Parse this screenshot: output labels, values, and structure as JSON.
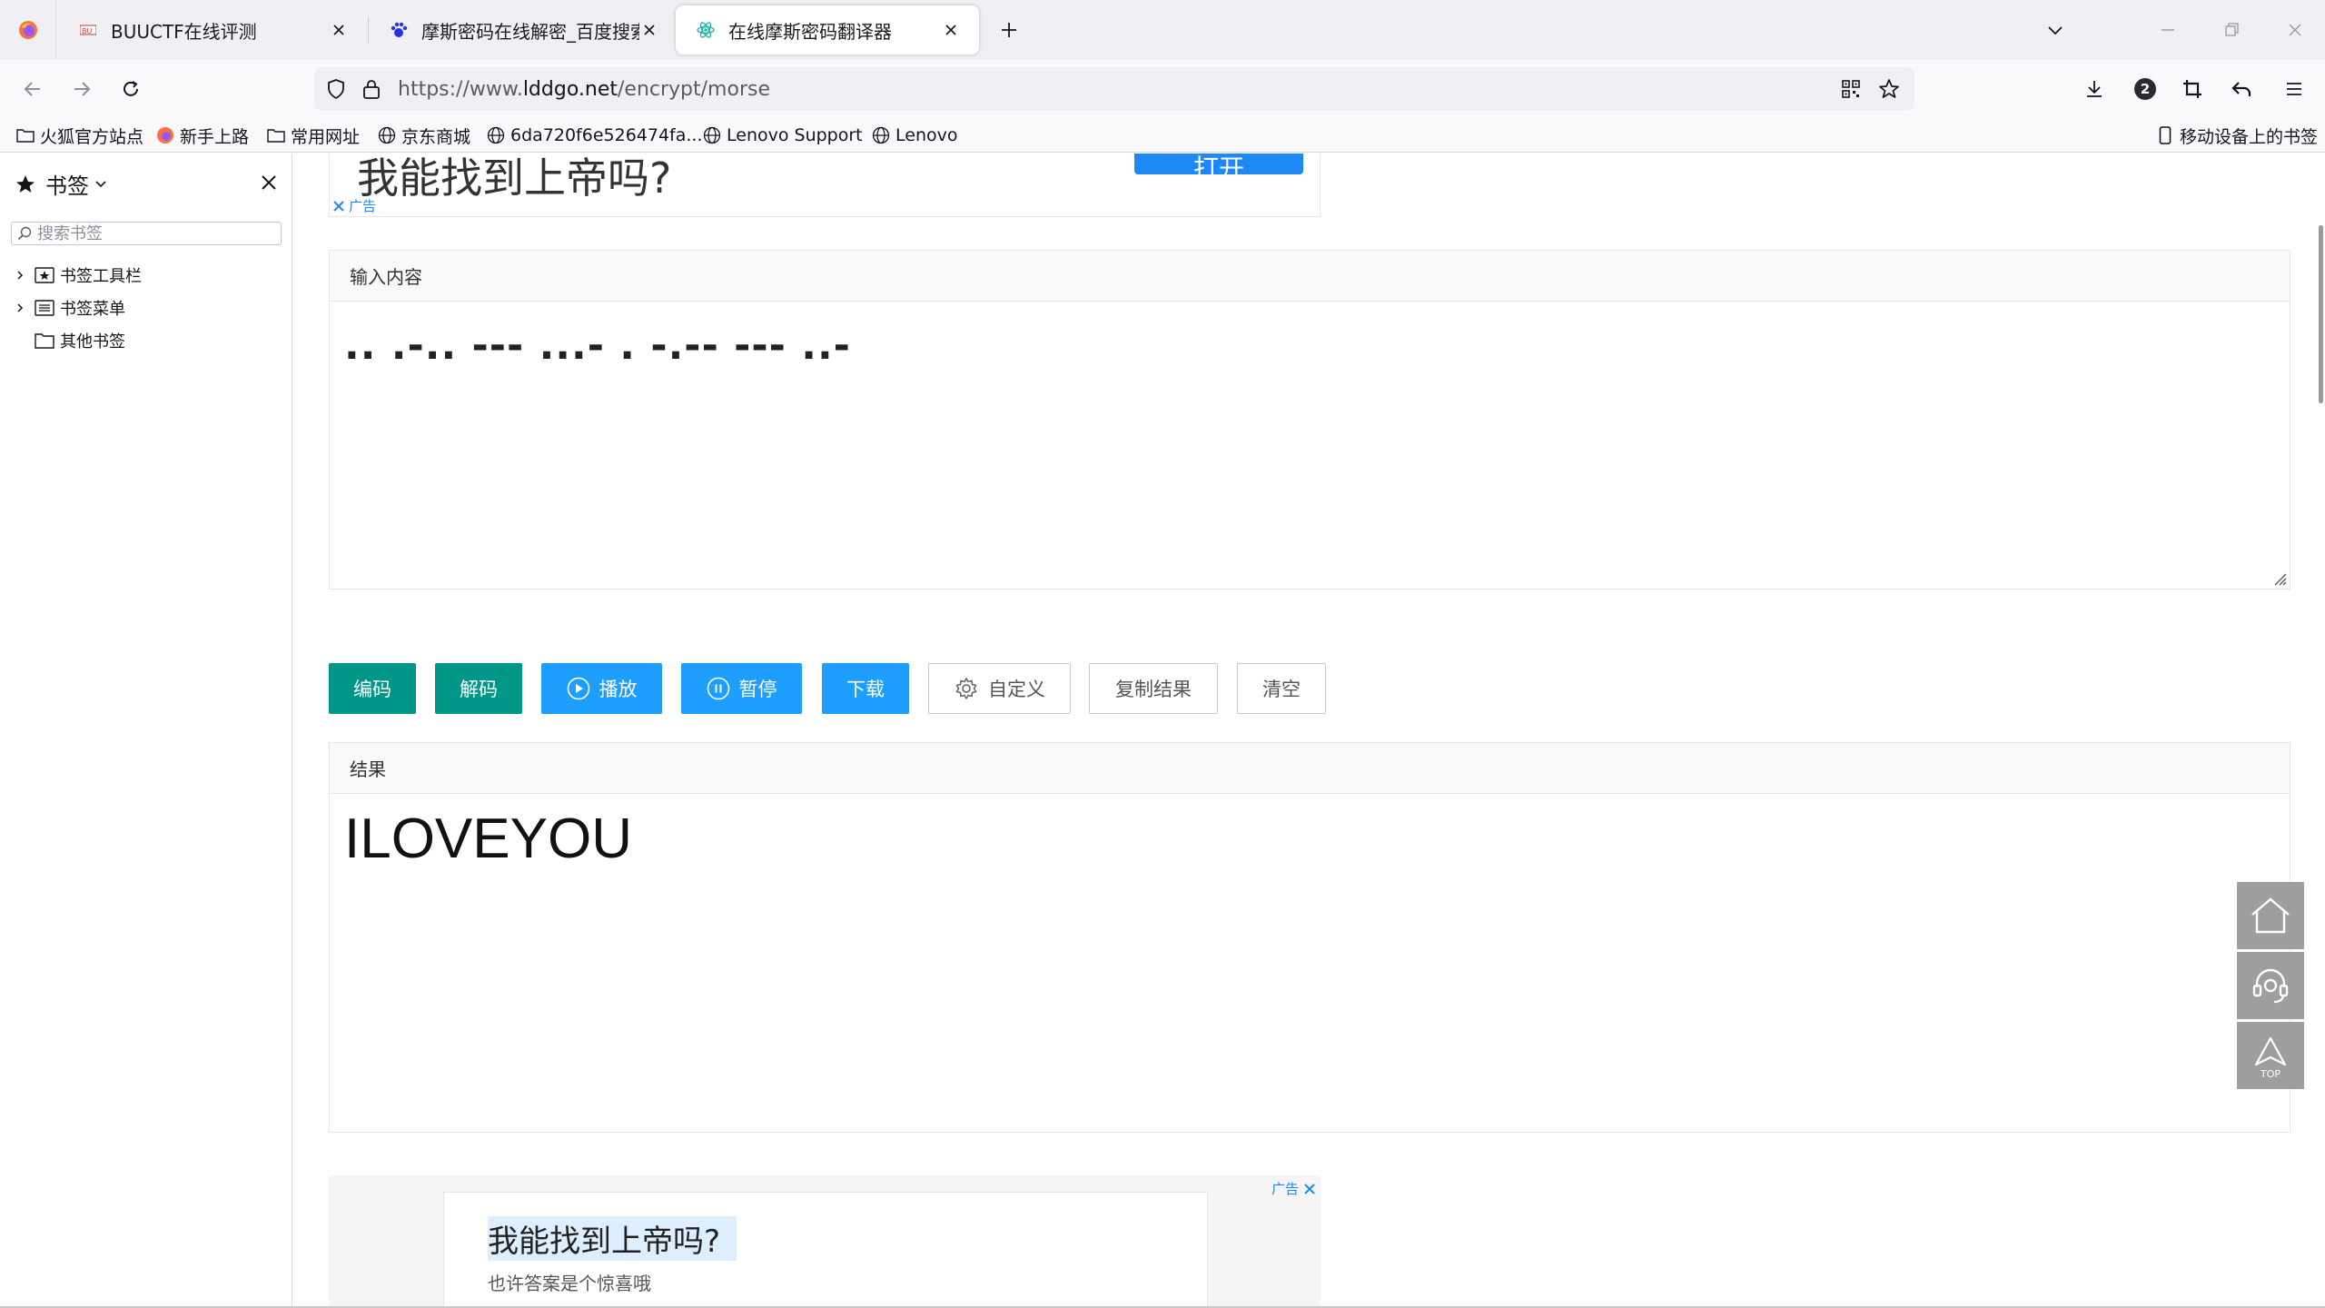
{
  "browser": {
    "tabs": [
      {
        "title": "BUUCTF在线评测",
        "active": false
      },
      {
        "title": "摩斯密码在线解密_百度搜索",
        "active": false
      },
      {
        "title": "在线摩斯密码翻译器",
        "active": true
      }
    ],
    "url_prefix": "https://www.",
    "url_host": "lddgo.net",
    "url_path": "/encrypt/morse",
    "notification_count": "2"
  },
  "bookmarks_bar": {
    "items": [
      {
        "label": "火狐官方站点",
        "icon": "folder-icon"
      },
      {
        "label": "新手上路",
        "icon": "firefox-icon"
      },
      {
        "label": "常用网址",
        "icon": "folder-icon"
      },
      {
        "label": "京东商城",
        "icon": "globe-icon"
      },
      {
        "label": "6da720f6e526474fa...",
        "icon": "globe-icon"
      },
      {
        "label": "Lenovo Support",
        "icon": "globe-icon"
      },
      {
        "label": "Lenovo",
        "icon": "globe-icon"
      }
    ],
    "mobile_bookmarks": "移动设备上的书签"
  },
  "sidebar": {
    "title": "书签",
    "search_placeholder": "搜索书签",
    "tree": [
      {
        "label": "书签工具栏",
        "expandable": true
      },
      {
        "label": "书签菜单",
        "expandable": true
      },
      {
        "label": "其他书签",
        "expandable": false
      }
    ]
  },
  "page": {
    "ad_top": {
      "text": "我能找到上帝吗?",
      "button": "打开",
      "label": "广告"
    },
    "input_panel": {
      "title": "输入内容",
      "value": ".. .-.. --- ...- . -.-- --- ..-"
    },
    "buttons": {
      "encode": "编码",
      "decode": "解码",
      "play": "播放",
      "pause": "暂停",
      "download": "下载",
      "custom": "自定义",
      "copy": "复制结果",
      "clear": "清空"
    },
    "result_panel": {
      "title": "结果",
      "value": "ILOVEYOU"
    },
    "ad_bottom": {
      "title": "我能找到上帝吗?",
      "subtitle": "也许答案是个惊喜哦",
      "label": "广告"
    },
    "float_buttons": [
      "home-icon",
      "support-icon",
      "back-to-top-icon"
    ],
    "top_label": "TOP"
  },
  "colors": {
    "green": "#009688",
    "blue": "#1e9fff",
    "ad_blue": "#1e88f5"
  }
}
